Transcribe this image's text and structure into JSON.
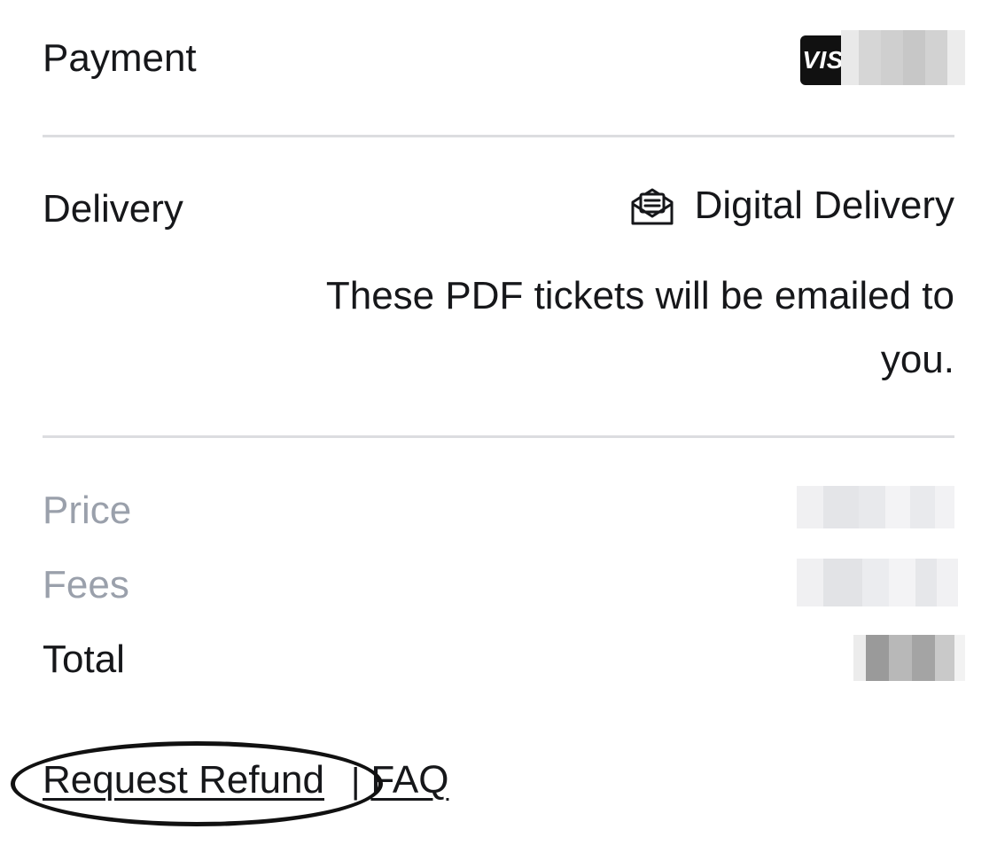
{
  "payment": {
    "label": "Payment",
    "card_brand": "VISA",
    "card_number_redacted": true
  },
  "delivery": {
    "label": "Delivery",
    "method": "Digital Delivery",
    "method_icon": "envelope-open-icon",
    "note": "These PDF tickets will be emailed to you."
  },
  "summary": {
    "price_label": "Price",
    "fees_label": "Fees",
    "total_label": "Total"
  },
  "links": {
    "refund_label": "Request Refund",
    "separator": "|",
    "faq_label": "FAQ"
  },
  "colors": {
    "text": "#16171a",
    "muted": "#9aa0ab",
    "divider": "#dcdde0",
    "visa_bg": "#111111"
  }
}
